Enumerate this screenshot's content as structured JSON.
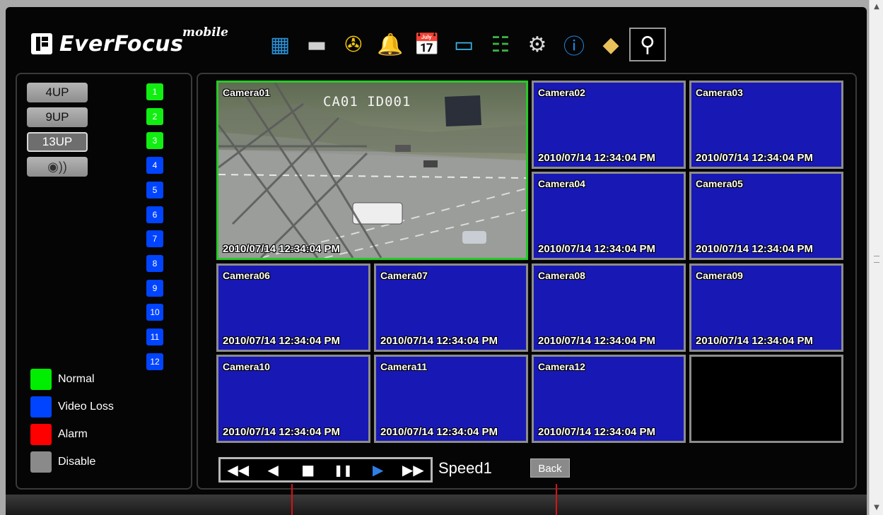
{
  "brand": {
    "name": "EverFocus",
    "suffix": "mobile"
  },
  "toolbar": [
    {
      "icon": "live-grid-icon",
      "glyph": "▦",
      "color": "#2a8fd6"
    },
    {
      "icon": "camera-icon",
      "glyph": "▬",
      "color": "#cfcfcf"
    },
    {
      "icon": "playback-film-icon",
      "glyph": "✇",
      "color": "#f1c40f"
    },
    {
      "icon": "alarm-bell-icon",
      "glyph": "🔔",
      "color": "#f5b700"
    },
    {
      "icon": "schedule-calendar-icon",
      "glyph": "📅",
      "color": "#e67e22"
    },
    {
      "icon": "monitor-icon",
      "glyph": "▭",
      "color": "#39b6e8"
    },
    {
      "icon": "network-icon",
      "glyph": "☷",
      "color": "#3cb043"
    },
    {
      "icon": "settings-gears-icon",
      "glyph": "⚙",
      "color": "#d9d9d9"
    },
    {
      "icon": "info-icon",
      "glyph": "ⓘ",
      "color": "#1e88e5"
    },
    {
      "icon": "notes-icon",
      "glyph": "◆",
      "color": "#e8c15a"
    },
    {
      "icon": "search-magnifier-icon",
      "glyph": "⚲",
      "color": "#ffffff",
      "active": true
    }
  ],
  "layouts": {
    "four_up": "4UP",
    "nine_up": "9UP",
    "thirteen_up": "13UP",
    "audio_glyph": "◉))"
  },
  "channels": [
    {
      "label": "1",
      "status": "normal"
    },
    {
      "label": "2",
      "status": "normal"
    },
    {
      "label": "3",
      "status": "normal"
    },
    {
      "label": "4",
      "status": "video_loss"
    },
    {
      "label": "5",
      "status": "video_loss"
    },
    {
      "label": "6",
      "status": "video_loss"
    },
    {
      "label": "7",
      "status": "video_loss"
    },
    {
      "label": "8",
      "status": "video_loss"
    },
    {
      "label": "9",
      "status": "video_loss"
    },
    {
      "label": "10",
      "status": "video_loss"
    },
    {
      "label": "11",
      "status": "video_loss"
    },
    {
      "label": "12",
      "status": "video_loss"
    }
  ],
  "legend": {
    "normal": {
      "label": "Normal",
      "color": "#00ee00"
    },
    "video_loss": {
      "label": "Video Loss",
      "color": "#0044ff"
    },
    "alarm": {
      "label": "Alarm",
      "color": "#ff0000"
    },
    "disable": {
      "label": "Disable",
      "color": "#8a8a8a"
    }
  },
  "cameras": {
    "cam01": {
      "name": "Camera01",
      "time": "2010/07/14  12:34:04 PM",
      "osd": "CA01  ID001"
    },
    "cam02": {
      "name": "Camera02",
      "time": "2010/07/14  12:34:04 PM"
    },
    "cam03": {
      "name": "Camera03",
      "time": "2010/07/14  12:34:04 PM"
    },
    "cam04": {
      "name": "Camera04",
      "time": "2010/07/14  12:34:04 PM"
    },
    "cam05": {
      "name": "Camera05",
      "time": "2010/07/14  12:34:04 PM"
    },
    "cam06": {
      "name": "Camera06",
      "time": "2010/07/14  12:34:04 PM"
    },
    "cam07": {
      "name": "Camera07",
      "time": "2010/07/14  12:34:04 PM"
    },
    "cam08": {
      "name": "Camera08",
      "time": "2010/07/14  12:34:04 PM"
    },
    "cam09": {
      "name": "Camera09",
      "time": "2010/07/14  12:34:04 PM"
    },
    "cam10": {
      "name": "Camera10",
      "time": "2010/07/14  12:34:04 PM"
    },
    "cam11": {
      "name": "Camera11",
      "time": "2010/07/14  12:34:04 PM"
    },
    "cam12": {
      "name": "Camera12",
      "time": "2010/07/14  12:34:04 PM"
    }
  },
  "playback": {
    "rewind": "◀◀",
    "step_back": "◀",
    "stop": "■",
    "pause": "❚❚",
    "play": "▶",
    "fast_forward": "▶▶",
    "speed": "Speed1",
    "back": "Back"
  },
  "scrollbar": {
    "up": "▲",
    "down": "▼"
  }
}
